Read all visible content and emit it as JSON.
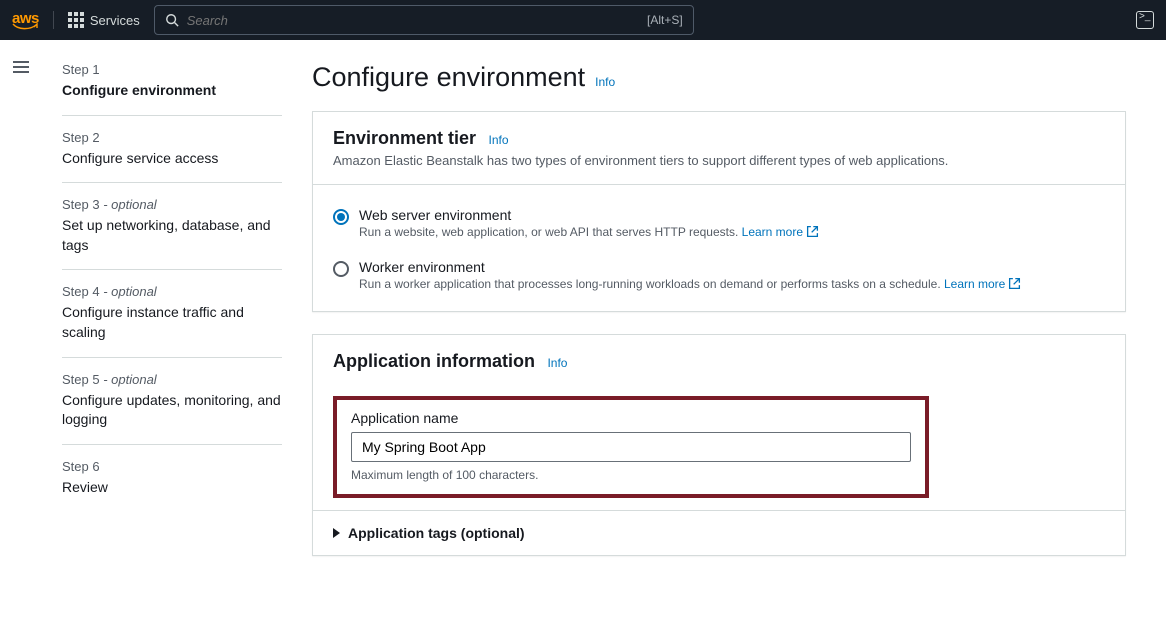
{
  "nav": {
    "logo": "aws",
    "services": "Services",
    "search_placeholder": "Search",
    "search_shortcut": "[Alt+S]"
  },
  "sidebar": {
    "steps": [
      {
        "num": "Step 1",
        "opt": "",
        "title": "Configure environment",
        "active": true
      },
      {
        "num": "Step 2",
        "opt": "",
        "title": "Configure service access",
        "active": false
      },
      {
        "num": "Step 3",
        "opt": " - optional",
        "title": "Set up networking, database, and tags",
        "active": false
      },
      {
        "num": "Step 4",
        "opt": " - optional",
        "title": "Configure instance traffic and scaling",
        "active": false
      },
      {
        "num": "Step 5",
        "opt": " - optional",
        "title": "Configure updates, monitoring, and logging",
        "active": false
      },
      {
        "num": "Step 6",
        "opt": "",
        "title": "Review",
        "active": false
      }
    ]
  },
  "page": {
    "title": "Configure environment",
    "info": "Info"
  },
  "env_tier": {
    "heading": "Environment tier",
    "info": "Info",
    "sub": "Amazon Elastic Beanstalk has two types of environment tiers to support different types of web applications.",
    "options": [
      {
        "title": "Web server environment",
        "desc": "Run a website, web application, or web API that serves HTTP requests.",
        "learn": "Learn more",
        "checked": true
      },
      {
        "title": "Worker environment",
        "desc": "Run a worker application that processes long-running workloads on demand or performs tasks on a schedule.",
        "learn": "Learn more",
        "checked": false
      }
    ]
  },
  "app_info": {
    "heading": "Application information",
    "info": "Info",
    "name_label": "Application name",
    "name_value": "My Spring Boot App",
    "name_hint": "Maximum length of 100 characters.",
    "tags_label": "Application tags (optional)"
  }
}
